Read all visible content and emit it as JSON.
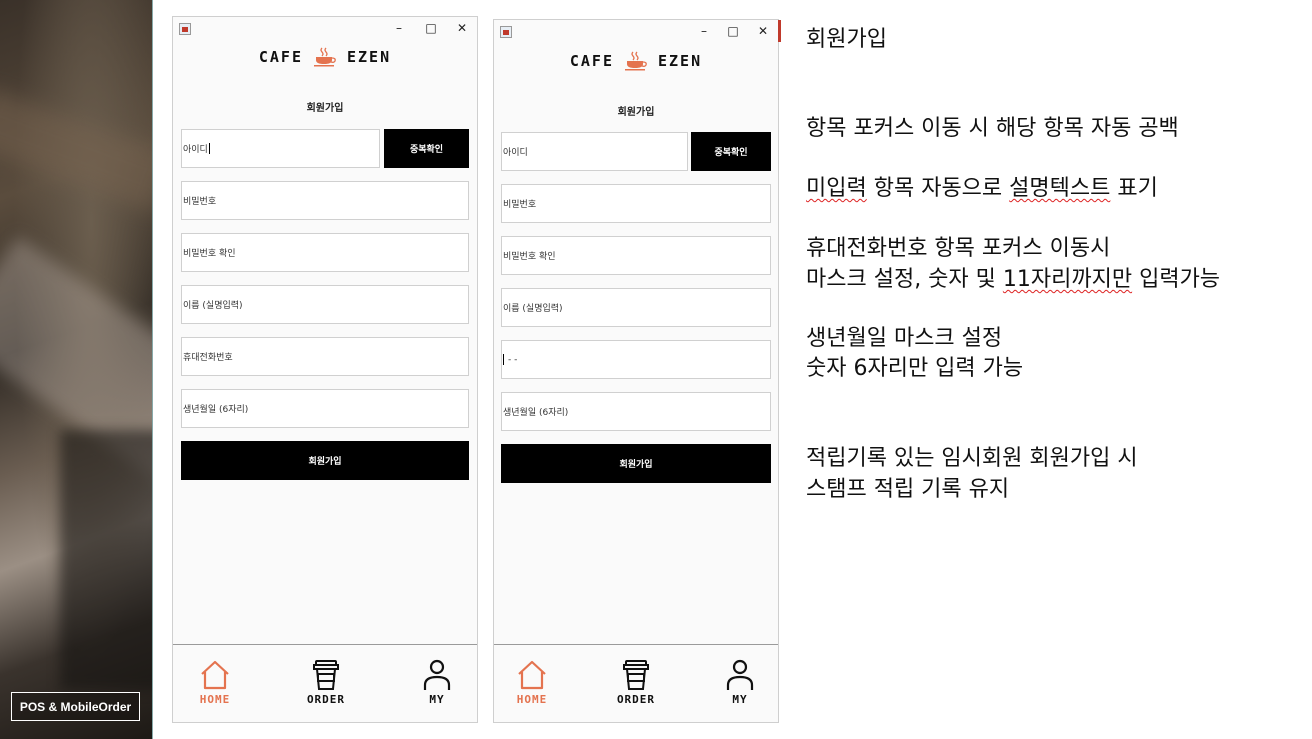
{
  "photo_badge": "POS & MobileOrder",
  "windows": [
    {
      "logo_left": "CAFE",
      "logo_right": "EZEN",
      "form_title": "회원가입",
      "fields": {
        "id": "아이디",
        "password": "비밀번호",
        "password_confirm": "비밀번호 확인",
        "name": "이름 (실명입력)",
        "phone": "휴대전화번호",
        "birth": "생년월일 (6자리)"
      },
      "check_button": "중복확인",
      "submit_button": "회원가입",
      "nav": {
        "home": "HOME",
        "order": "ORDER",
        "my": "MY"
      }
    },
    {
      "logo_left": "CAFE",
      "logo_right": "EZEN",
      "form_title": "회원가입",
      "fields": {
        "id": "아이디",
        "password": "비밀번호",
        "password_confirm": "비밀번호 확인",
        "name": "이름 (실명입력)",
        "phone": "-  -",
        "birth": "생년월일 (6자리)"
      },
      "check_button": "중복확인",
      "submit_button": "회원가입",
      "nav": {
        "home": "HOME",
        "order": "ORDER",
        "my": "MY"
      }
    }
  ],
  "window_controls": {
    "minimize": "–",
    "maximize": "□",
    "close": "✕"
  },
  "notes": {
    "title": "회원가입",
    "line1": "항목 포커스 이동 시 해당 항목 자동 공백",
    "line2_a": "미입력",
    "line2_b": " 항목 자동으로 ",
    "line2_c": "설명텍스트",
    "line2_d": " 표기",
    "line3": "휴대전화번호 항목 포커스 이동시",
    "line4_a": "마스크 설정, 숫자 및 ",
    "line4_b": "11자리까지만",
    "line4_c": " 입력가능",
    "line5": "생년월일 마스크 설정",
    "line6": "숫자 6자리만 입력 가능",
    "line7": "적립기록 있는 임시회원 회원가입 시",
    "line8": "스탬프 적립 기록 유지"
  },
  "colors": {
    "accent": "#e4734f",
    "button": "#000000",
    "squiggle": "#dd2222"
  }
}
